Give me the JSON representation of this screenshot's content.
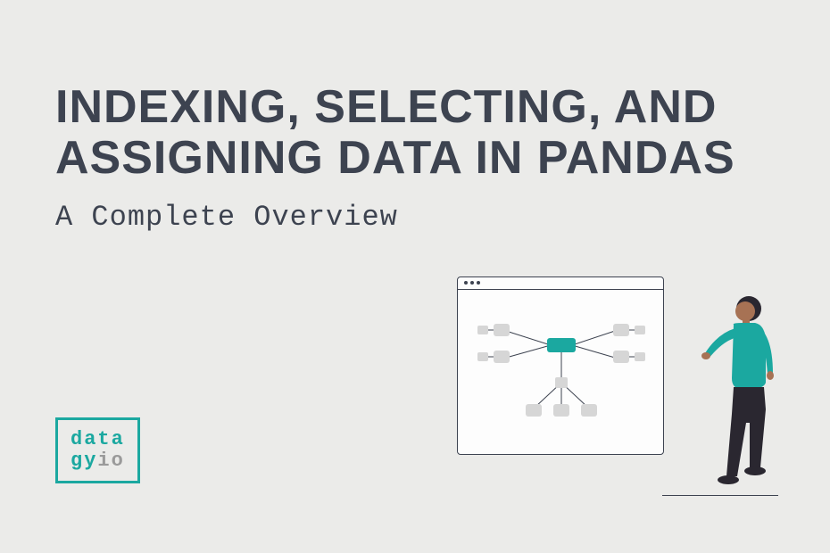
{
  "title": "INDEXING, SELECTING, AND ASSIGNING DATA IN PANDAS",
  "subtitle": "A Complete Overview",
  "logo": {
    "line1": "data",
    "line2_part1": "gy",
    "line2_part2": "io"
  },
  "colors": {
    "accent": "#1ba8a0",
    "text": "#3d4350",
    "muted": "#9a9a9a",
    "bg": "#ebebe9"
  }
}
